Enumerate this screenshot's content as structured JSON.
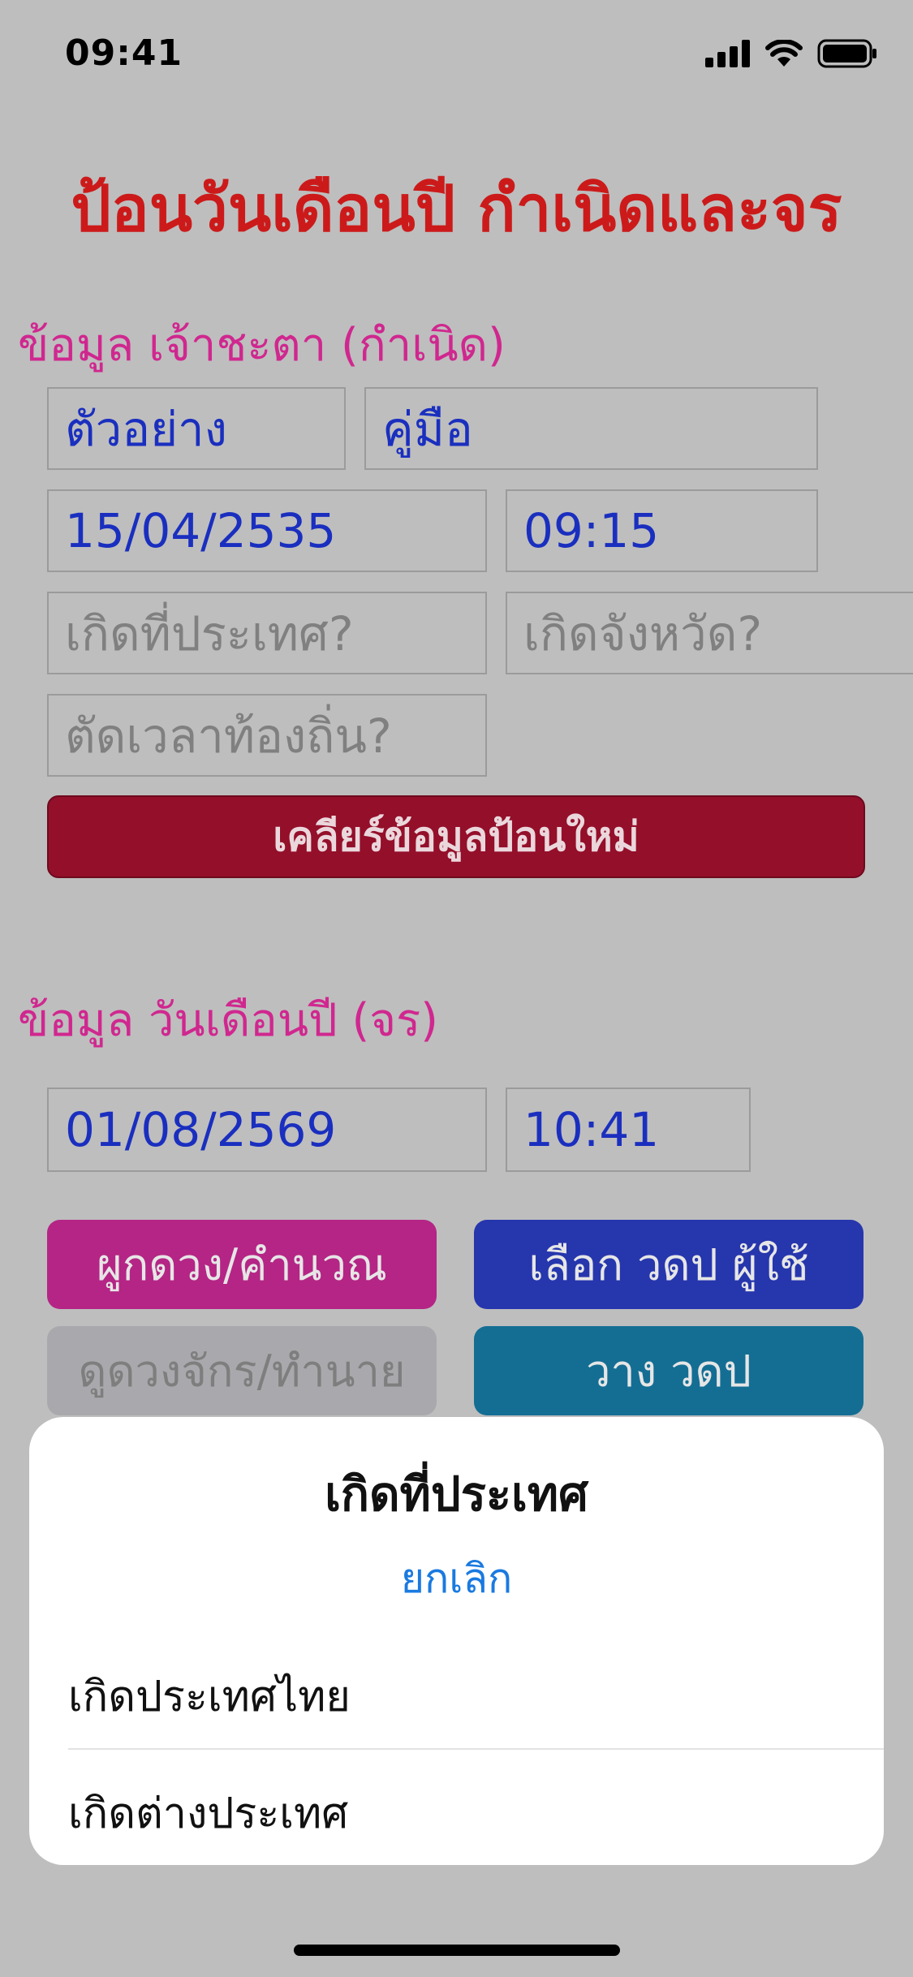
{
  "status_bar": {
    "time": "09:41"
  },
  "title": "ป้อนวันเดือนปี กำเนิดและจร",
  "birth_section": {
    "heading": "ข้อมูล เจ้าชะตา (กำเนิด)",
    "example_value": "ตัวอย่าง",
    "manual_value": "คู่มือ",
    "date_value": "15/04/2535",
    "time_value": "09:15",
    "country_placeholder": "เกิดที่ประเทศ?",
    "province_placeholder": "เกิดจังหวัด?",
    "localtime_placeholder": "ตัดเวลาท้องถิ่น?",
    "clear_button": "เคลียร์ข้อมูลป้อนใหม่"
  },
  "transit_section": {
    "heading": "ข้อมูล วันเดือนปี (จร)",
    "date_value": "01/08/2569",
    "time_value": "10:41"
  },
  "actions": {
    "chart": "ผูกดวง/คำนวณ",
    "select_user": "เลือก วดป ผู้ใช้",
    "view_wheel": "ดูดวงจักร/ทำนาย",
    "paste": "วาง วดป"
  },
  "colors": {
    "chart_button": "#b42585",
    "select_user_button": "#2636ad",
    "view_wheel_button": "#a9a9ad",
    "paste_button": "#146e94"
  },
  "sheet": {
    "title": "เกิดที่ประเทศ",
    "cancel": "ยกเลิก",
    "options": [
      "เกิดประเทศไทย",
      "เกิดต่างประเทศ"
    ]
  }
}
